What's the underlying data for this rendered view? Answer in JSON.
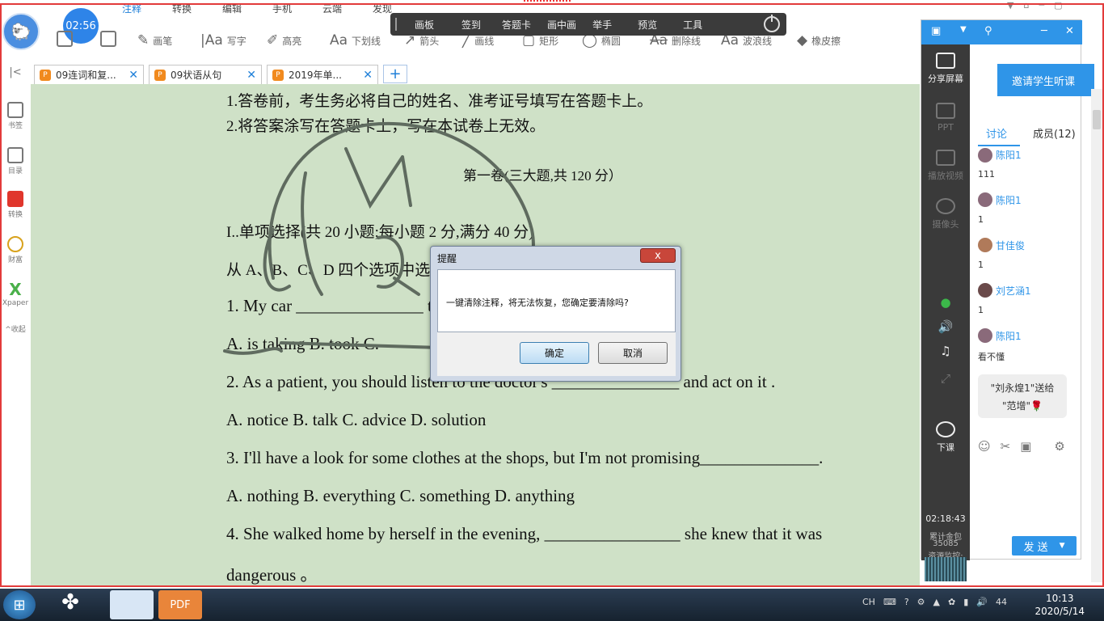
{
  "menu": {
    "tabs": [
      "注释",
      "转换",
      "编辑",
      "手机",
      "云端",
      "发现"
    ],
    "active": "注释",
    "clock": "02:56"
  },
  "tools": {
    "pen": "画笔",
    "write": "写字",
    "highlight": "高亮",
    "underline": "下划线",
    "arrow": "箭头",
    "line": "画线",
    "rect": "矩形",
    "ellipse": "椭圆",
    "strike": "删除线",
    "wave": "波浪线",
    "eraser": "橡皮擦"
  },
  "floatbar": {
    "items": [
      "画板",
      "签到",
      "答题卡",
      "画中画",
      "举手",
      "预览",
      "工具"
    ]
  },
  "tabs": [
    {
      "label": "09连词和复..."
    },
    {
      "label": "09状语从句"
    },
    {
      "label": "2019年单..."
    }
  ],
  "leftbar": {
    "items": [
      "书签",
      "目录",
      "转换",
      "财富",
      "Xpaper"
    ],
    "collapse": "收起"
  },
  "doc": {
    "lines": [
      "1.答卷前，考生务必将自己的姓名、准考证号填写在答题卡上。",
      "2.将答案涂写在答题卡上，写在本试卷上无效。",
      "第一卷(三大题,共 120 分）",
      "I..单项选择(共 20 小题;每小题 2 分,满分 40 分)",
      "从 A、B、C、D 四个选项中选出可以填入空白处的最佳答案。",
      "1. My car _______________ the four seat belts .",
      "A. is taking    B. took    C.",
      "2. As a patient, you should listen to the doctor's _______________ and act on it .",
      "A. notice    B. talk    C. advice    D. solution",
      "3. I'll have a look for some clothes at the shops, but I'm not promising______________.",
      "A. nothing    B. everything    C. something    D. anything",
      "4. She walked home by herself in the evening, ________________ she knew that it was",
      "dangerous  。"
    ]
  },
  "dialog": {
    "title": "提醒",
    "message": "一键清除注释，将无法恢复，您确定要清除吗?",
    "ok": "确定",
    "cancel": "取消",
    "close": "x"
  },
  "panel": {
    "share": "分享屏幕",
    "ppt": "PPT",
    "video": "播放视频",
    "camera": "摄像头",
    "end": "下课",
    "timer": "02:18:43",
    "stat1": "累计金包",
    "stat2": "35085",
    "stat3": "资源监控:",
    "invite": "邀请学生听课",
    "tab_discuss": "讨论",
    "tab_members": "成员(12)",
    "messages": [
      {
        "name": "陈阳1",
        "text": "111"
      },
      {
        "name": "陈阳1",
        "text": "1"
      },
      {
        "name": "甘佳俊",
        "text": "1"
      },
      {
        "name": "刘艺涵1",
        "text": "1"
      },
      {
        "name": "陈阳1",
        "text": "看不懂"
      }
    ],
    "gift_line1": "\"刘永煌1\"送给",
    "gift_line2": "\"范增\"🌹",
    "send": "发 送"
  },
  "taskbar": {
    "lang": "CH",
    "time": "10:13",
    "date": "2020/5/14",
    "vol": "44"
  }
}
